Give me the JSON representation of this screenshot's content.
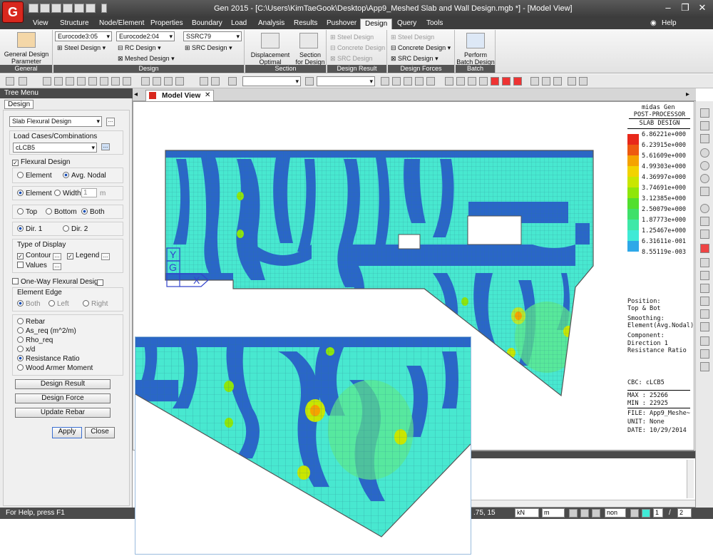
{
  "window": {
    "title": "Gen 2015 - [C:\\Users\\KimTaeGook\\Desktop\\App9_Meshed Slab and Wall Design.mgb *] - [Model View]",
    "logo_text": "G",
    "help_label": "Help"
  },
  "menu_tabs": [
    "View",
    "Structure",
    "Node/Element",
    "Properties",
    "Boundary",
    "Load",
    "Analysis",
    "Results",
    "Pushover",
    "Design",
    "Query",
    "Tools"
  ],
  "ribbon": {
    "general": {
      "button": "General Design Parameter",
      "group": "General"
    },
    "design": {
      "eurocode_steel": "Eurocode3:05",
      "steel_design": "Steel Design",
      "eurocode_rc": "Eurocode2:04",
      "rc_design": "RC Design",
      "meshed_design": "Meshed Design",
      "src_code": "SSRC79",
      "src_design": "SRC Design",
      "group": "Design"
    },
    "section": {
      "displacement": "Displacement Optimal Design...",
      "section_for_design": "Section for Design",
      "group": "Section"
    },
    "design_result": {
      "steel": "Steel Design",
      "concrete": "Concrete Design",
      "src": "SRC Design",
      "group": "Design Result"
    },
    "design_forces": {
      "steel": "Steel Design",
      "concrete": "Concrete Design",
      "src": "SRC Design",
      "group": "Design Forces"
    },
    "batch": {
      "button": "Perform Batch Design",
      "group": "Batch"
    }
  },
  "tree": {
    "header": "Tree Menu",
    "tab": "Design",
    "design_type": "Slab Flexural Design",
    "load_cases_label": "Load Cases/Combinations",
    "load_case": "cLCB5",
    "flexural_design": "Flexural Design",
    "element": "Element",
    "avg_nodal": "Avg. Nodal",
    "element2": "Element",
    "width": "Width",
    "width_value": "1",
    "width_unit": "m",
    "top": "Top",
    "bottom": "Bottom",
    "both": "Both",
    "dir1": "Dir. 1",
    "dir2": "Dir. 2",
    "type_of_display": "Type of Display",
    "contour": "Contour",
    "legend": "Legend",
    "values": "Values",
    "one_way": "One-Way Flexural Design",
    "element_edge": "Element Edge",
    "edge_both": "Both",
    "edge_left": "Left",
    "edge_right": "Right",
    "results": [
      "Rebar",
      "As_req  (m^2/m)",
      "Rho_req",
      "x/d",
      "Resistance Ratio",
      "Wood Armer Moment"
    ],
    "btn_design_result": "Design Result",
    "btn_design_force": "Design Force",
    "btn_update_rebar": "Update Rebar",
    "btn_apply": "Apply",
    "btn_close": "Close"
  },
  "view_tab": "Model View",
  "legend": {
    "title1": "midas Gen",
    "title2": "POST-PROCESSOR",
    "title3": "SLAB DESIGN",
    "levels": [
      "6.86221e+000",
      "6.23915e+000",
      "5.61609e+000",
      "4.99303e+000",
      "4.36997e+000",
      "3.74691e+000",
      "3.12385e+000",
      "2.50079e+000",
      "1.87773e+000",
      "1.25467e+000",
      "6.31611e-001",
      "8.55119e-003"
    ],
    "band_colors": [
      "#e8281a",
      "#ee5a10",
      "#f5a300",
      "#f2d300",
      "#c9e600",
      "#8fe60a",
      "#52df2e",
      "#3fe06a",
      "#3ee8a8",
      "#40ead6",
      "#2ea8e8",
      "#2266cc"
    ],
    "info": [
      "Position:",
      " Top & Bot",
      "Smoothing:",
      " Element(Avg.Nodal)",
      "Component:",
      " Direction 1",
      " Resistance Ratio"
    ],
    "cbc": "CBC: cLCB5",
    "max": "MAX : 25266",
    "min": "MIN : 22925",
    "file": "FILE: App9_Meshe~",
    "unit": "UNIT: None",
    "date": "DATE: 10/29/2014"
  },
  "axis": {
    "y": "Y",
    "g": "G",
    "x": "X"
  },
  "status": {
    "help_text": "For Help, press F1",
    "coord": ".75, 15",
    "force_unit": "kN",
    "length_unit": "m",
    "none_option": "non",
    "page_current": "1",
    "page_total": "2"
  }
}
